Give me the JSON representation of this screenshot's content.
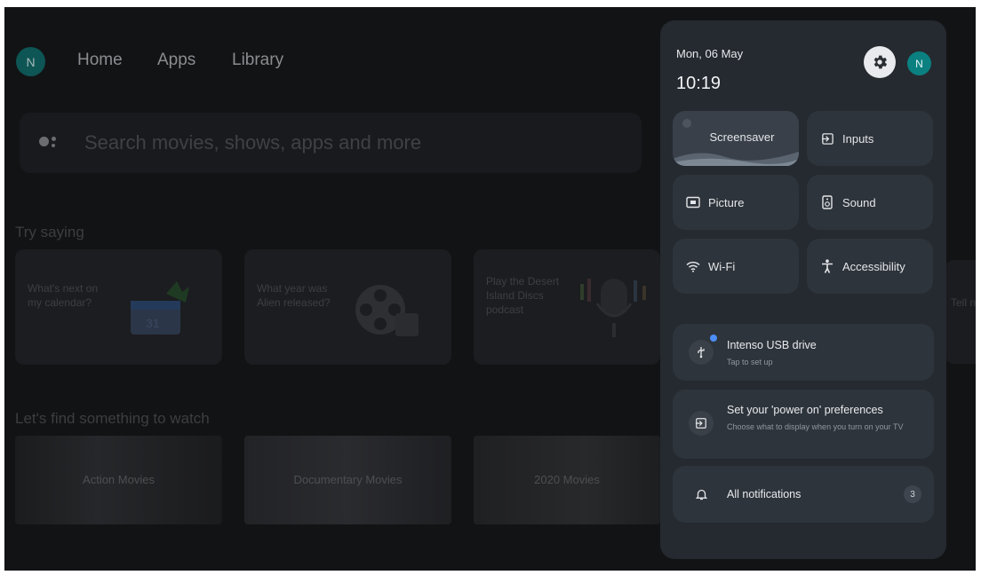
{
  "nav": {
    "avatar_letter": "N",
    "items": [
      "Home",
      "Apps",
      "Library"
    ]
  },
  "search": {
    "placeholder": "Search movies, shows, apps and more"
  },
  "try_saying": {
    "title": "Try saying",
    "cards": [
      {
        "text": "What's next on my calendar?",
        "icon": "calendar-icon"
      },
      {
        "text": "What year was Alien released?",
        "icon": "film-reel-icon"
      },
      {
        "text": "Play the Desert Island Discs podcast",
        "icon": "microphone-icon"
      }
    ],
    "cut_off_text": "Tell n"
  },
  "watch": {
    "title": "Let's find something to watch",
    "rows": [
      "Action Movies",
      "Documentary Movies",
      "2020 Movies"
    ]
  },
  "quick_settings": {
    "date": "Mon, 06 May",
    "time": "10:19",
    "avatar_letter": "N",
    "tiles": [
      {
        "label": "Screensaver",
        "icon": ""
      },
      {
        "label": "Inputs",
        "icon": "input-icon"
      },
      {
        "label": "Picture",
        "icon": "picture-icon"
      },
      {
        "label": "Sound",
        "icon": "speaker-icon"
      },
      {
        "label": "Wi-Fi",
        "icon": "wifi-icon"
      },
      {
        "label": "Accessibility",
        "icon": "accessibility-icon"
      }
    ],
    "usb": {
      "title": "Intenso USB drive",
      "subtitle": "Tap to set up"
    },
    "power": {
      "title": "Set your 'power on' preferences",
      "subtitle": "Choose what to display when you turn on your TV"
    },
    "notifications": {
      "title": "All notifications",
      "count": "3"
    }
  },
  "colors": {
    "panel_bg": "#252a30",
    "tile_bg": "#2e343b",
    "avatar": "#0b8080",
    "usb_dot": "#4c8df6"
  }
}
